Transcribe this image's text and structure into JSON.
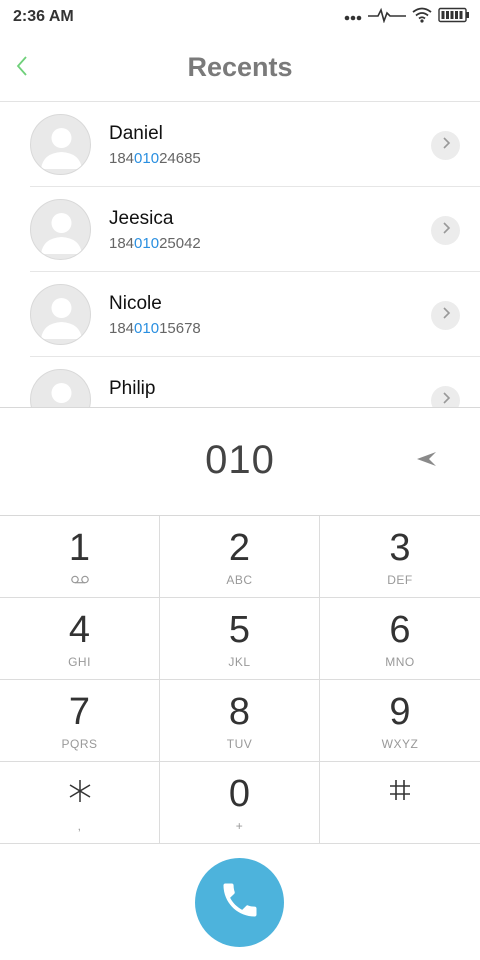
{
  "status_bar": {
    "time": "2:36 AM",
    "icons": [
      "dots-icon",
      "pulse-icon",
      "wifi-icon",
      "battery-icon"
    ]
  },
  "header": {
    "title": "Recents",
    "back_icon": "chevron-left-icon",
    "accent_color": "#6fd07a"
  },
  "recents": [
    {
      "name": "Daniel",
      "number_prefix": "184",
      "number_match": "010",
      "number_suffix": "24685"
    },
    {
      "name": "Jeesica",
      "number_prefix": "184",
      "number_match": "010",
      "number_suffix": "25042"
    },
    {
      "name": "Nicole",
      "number_prefix": "184",
      "number_match": "010",
      "number_suffix": "15678"
    },
    {
      "name": "Philip",
      "number_prefix": "",
      "number_match": "",
      "number_suffix": ""
    }
  ],
  "dialer": {
    "entered_number": "010",
    "delete_icon": "backspace-arrow-icon",
    "highlight_color": "#2a8fe0"
  },
  "keypad": [
    {
      "digit": "1",
      "letters": ""
    },
    {
      "digit": "2",
      "letters": "ABC"
    },
    {
      "digit": "3",
      "letters": "DEF"
    },
    {
      "digit": "4",
      "letters": "GHI"
    },
    {
      "digit": "5",
      "letters": "JKL"
    },
    {
      "digit": "6",
      "letters": "MNO"
    },
    {
      "digit": "7",
      "letters": "PQRS"
    },
    {
      "digit": "8",
      "letters": "TUV"
    },
    {
      "digit": "9",
      "letters": "WXYZ"
    },
    {
      "digit": "*",
      "letters": ","
    },
    {
      "digit": "0",
      "letters": "+"
    },
    {
      "digit": "#",
      "letters": ""
    }
  ],
  "call_button": {
    "icon": "phone-icon",
    "color": "#4db3dc"
  }
}
